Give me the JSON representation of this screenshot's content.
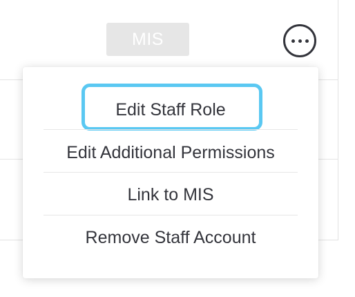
{
  "row": {
    "badge_label": "MIS",
    "more_icon": "more-horizontal-icon"
  },
  "menu": {
    "items": [
      {
        "label": "Edit Staff Role",
        "focused": true
      },
      {
        "label": "Edit Additional Permissions"
      },
      {
        "label": "Link to MIS"
      },
      {
        "label": "Remove Staff Account"
      }
    ]
  },
  "colors": {
    "text": "#33343b",
    "focus_ring": "#5ac8f2",
    "badge_bg": "#e6e6e6",
    "badge_text": "#ffffff"
  }
}
